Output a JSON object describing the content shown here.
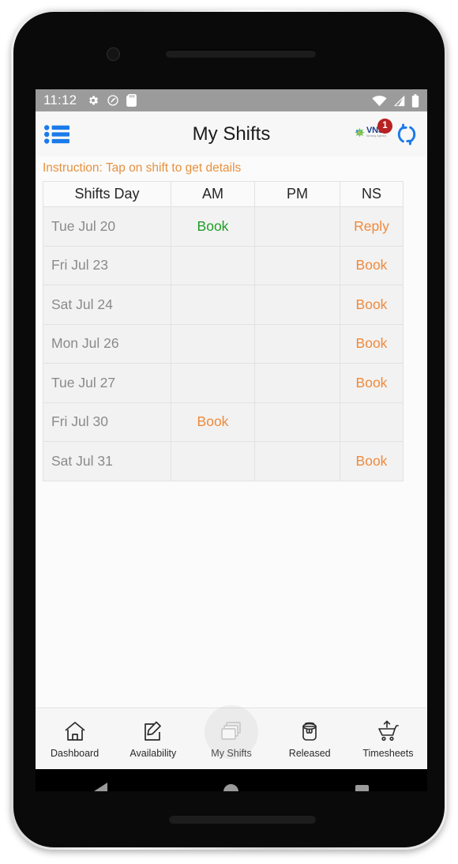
{
  "status_bar": {
    "time": "11:12",
    "left_icons": [
      "gear-icon",
      "no-location-icon",
      "sd-card-icon"
    ],
    "right_icons": [
      "wifi-icon",
      "signal-icon",
      "battery-icon"
    ]
  },
  "app_bar": {
    "menu_icon": "list-menu-icon",
    "title": "My Shifts",
    "logo_text": "VNS",
    "logo_subtext": "Nursing Agency",
    "badge_count": "1",
    "refresh_icon": "sync-refresh-icon"
  },
  "instruction": "Instruction: Tap on shift to get details",
  "table": {
    "headers": [
      "Shifts Day",
      "AM",
      "PM",
      "NS"
    ],
    "rows": [
      {
        "day": "Tue Jul 20",
        "am": "Book",
        "am_state": "available",
        "pm": "",
        "pm_state": "",
        "ns": "Reply",
        "ns_state": "pending"
      },
      {
        "day": "Fri Jul 23",
        "am": "",
        "am_state": "",
        "pm": "",
        "pm_state": "",
        "ns": "Book",
        "ns_state": "pending"
      },
      {
        "day": "Sat Jul 24",
        "am": "",
        "am_state": "",
        "pm": "",
        "pm_state": "",
        "ns": "Book",
        "ns_state": "pending"
      },
      {
        "day": "Mon Jul 26",
        "am": "",
        "am_state": "",
        "pm": "",
        "pm_state": "",
        "ns": "Book",
        "ns_state": "pending"
      },
      {
        "day": "Tue Jul 27",
        "am": "",
        "am_state": "",
        "pm": "",
        "pm_state": "",
        "ns": "Book",
        "ns_state": "pending"
      },
      {
        "day": "Fri Jul 30",
        "am": "Book",
        "am_state": "pending",
        "pm": "",
        "pm_state": "",
        "ns": "",
        "ns_state": ""
      },
      {
        "day": "Sat Jul 31",
        "am": "",
        "am_state": "",
        "pm": "",
        "pm_state": "",
        "ns": "Book",
        "ns_state": "pending"
      }
    ]
  },
  "tab_bar": {
    "active": "My Shifts",
    "tabs": [
      {
        "label": "Dashboard",
        "icon": "home-icon"
      },
      {
        "label": "Availability",
        "icon": "edit-square-icon"
      },
      {
        "label": "My Shifts",
        "icon": "layered-cards-icon"
      },
      {
        "label": "Released",
        "icon": "paint-bucket-icon"
      },
      {
        "label": "Timesheets",
        "icon": "cart-upload-icon"
      }
    ]
  },
  "nav_bar": {
    "back": "back-triangle-icon",
    "home": "home-circle-icon",
    "recents": "recents-square-icon"
  },
  "colors": {
    "accent_orange": "#ef8a3c",
    "accent_green": "#1f9d27",
    "accent_blue": "#1a7bea",
    "badge_red": "#b72222",
    "status_bar_grey": "#9b9b9b"
  }
}
